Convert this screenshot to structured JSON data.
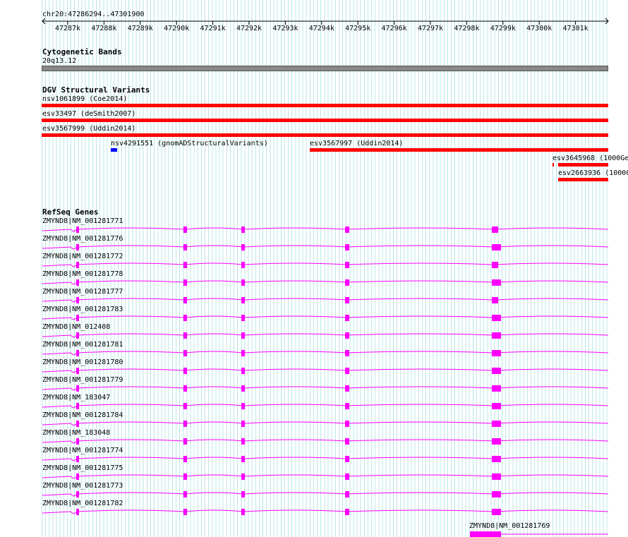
{
  "location": "chr20:47286294..47301900",
  "ruler_ticks": [
    "47287k",
    "47288k",
    "47289k",
    "47290k",
    "47291k",
    "47292k",
    "47293k",
    "47294k",
    "47295k",
    "47296k",
    "47297k",
    "47298k",
    "47299k",
    "47300k",
    "47301k"
  ],
  "cytobands": {
    "title": "Cytogenetic Bands",
    "band_label": "20q13.12"
  },
  "dgv": {
    "title": "DGV Structural Variants",
    "variants": [
      {
        "label": "nsv1061899 (Coe2014)",
        "color": "#ff0000"
      },
      {
        "label": "esv33497 (deSmith2007)",
        "color": "#ff0000"
      },
      {
        "label": "esv3567999 (Uddin2014)",
        "color": "#ff0000"
      },
      {
        "label": "nsv4291551 (gnomADStructuralVariants)",
        "color": "#0000ff"
      },
      {
        "label": "esv3567997 (Uddin2014)",
        "color": "#ff0000"
      },
      {
        "label": "esv3645968 (1000Ge",
        "color": "#ff0000"
      },
      {
        "label": "esv2663936 (10000",
        "color": "#ff0000"
      }
    ]
  },
  "refseq": {
    "title": "RefSeq Genes",
    "color": "#ff00ff",
    "transcripts": [
      "ZMYND8|NM_001281771",
      "ZMYND8|NM_001281776",
      "ZMYND8|NM_001281772",
      "ZMYND8|NM_001281778",
      "ZMYND8|NM_001281777",
      "ZMYND8|NM_001281783",
      "ZMYND8|NM_012408",
      "ZMYND8|NM_001281781",
      "ZMYND8|NM_001281780",
      "ZMYND8|NM_001281779",
      "ZMYND8|NM_183047",
      "ZMYND8|NM_001281784",
      "ZMYND8|NM_183048",
      "ZMYND8|NM_001281774",
      "ZMYND8|NM_001281775",
      "ZMYND8|NM_001281773",
      "ZMYND8|NM_001281782"
    ],
    "last_transcript": "ZMYND8|NM_001281769"
  }
}
